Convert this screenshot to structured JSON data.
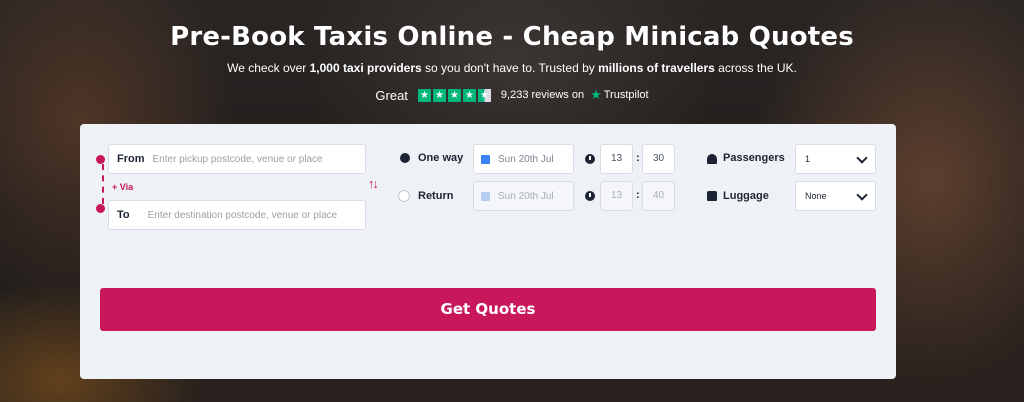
{
  "hero": {
    "title": "Pre-Book Taxis Online - Cheap Minicab Quotes",
    "sub_1": "We check over ",
    "sub_b1": "1,000 taxi providers",
    "sub_2": " so you don't have to. Trusted by ",
    "sub_b2": "millions of travellers",
    "sub_3": " across the UK."
  },
  "trustpilot": {
    "rating_word": "Great",
    "stars": 4.5,
    "reviews": "9,233 reviews on",
    "brand": "Trustpilot",
    "brand_color": "#00b67a"
  },
  "form": {
    "from_label": "From",
    "from_placeholder": "Enter pickup postcode, venue or place",
    "to_label": "To",
    "to_placeholder": "Enter destination postcode, venue or place",
    "via_label": "+ Via",
    "swap_icon": "↑↓",
    "one_way_label": "One way",
    "return_label": "Return",
    "one_way_date": "Sun 20th Jul",
    "return_date": "Sun 20th Jul",
    "one_way_hour": "13",
    "one_way_min": "30",
    "return_hour": "13",
    "return_min": "40",
    "colon": ":",
    "passengers_label": "Passengers",
    "passengers_value": "1",
    "luggage_label": "Luggage",
    "luggage_value": "None",
    "submit_label": "Get Quotes",
    "accent_color": "#c8175a"
  }
}
